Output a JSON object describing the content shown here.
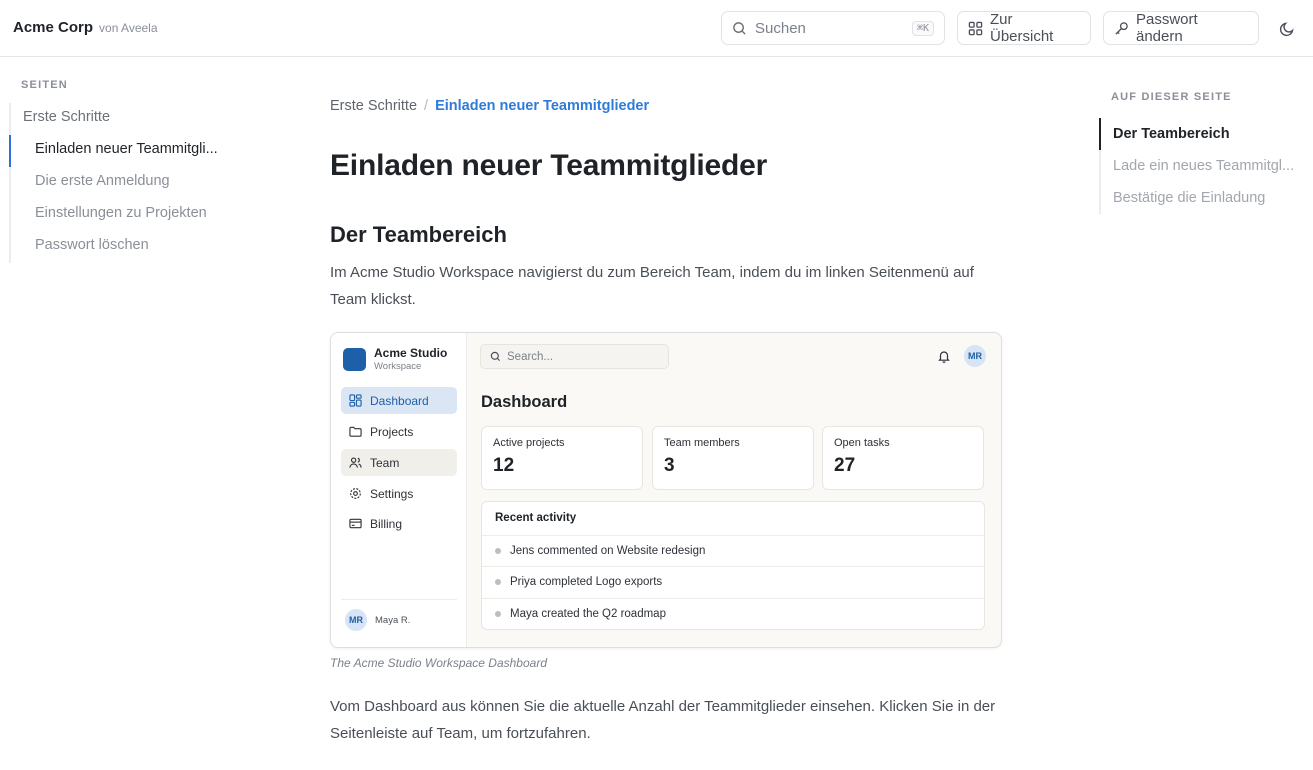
{
  "header": {
    "brand": "Acme Corp",
    "brand_sub": "von Aveela",
    "search_placeholder": "Suchen",
    "search_shortcut": "⌘K",
    "overview_label": "Zur Übersicht",
    "password_label": "Passwort ändern"
  },
  "sidebar": {
    "heading": "SEITEN",
    "parent": "Erste Schritte",
    "items": [
      "Einladen neuer Teammitgli...",
      "Die erste Anmeldung",
      "Einstellungen zu Projekten",
      "Passwort löschen"
    ]
  },
  "main": {
    "breadcrumb": {
      "root": "Erste Schritte",
      "sep": "/",
      "current": "Einladen neuer Teammitglieder"
    },
    "title": "Einladen neuer Teammitglieder",
    "section_title": "Der Teambereich",
    "para1": "Im Acme Studio Workspace navigierst du zum Bereich Team, indem du im linken Seitenmenü auf Team klickst.",
    "caption": "The Acme Studio Workspace Dashboard",
    "para2": "Vom Dashboard aus können Sie die aktuelle Anzahl der Teammitglieder einsehen. Klicken Sie in der Seitenleiste auf Team, um fortzufahren."
  },
  "shot": {
    "ws_name": "Acme Studio",
    "ws_sub": "Workspace",
    "search": "Search...",
    "avatar": "MR",
    "nav": [
      "Dashboard",
      "Projects",
      "Team",
      "Settings",
      "Billing"
    ],
    "user_initials": "MR",
    "user_name": "Maya R.",
    "title": "Dashboard",
    "stats": [
      {
        "label": "Active projects",
        "value": "12"
      },
      {
        "label": "Team members",
        "value": "3"
      },
      {
        "label": "Open tasks",
        "value": "27"
      }
    ],
    "activity_title": "Recent activity",
    "activity": [
      "Jens commented on Website redesign",
      "Priya completed Logo exports",
      "Maya created the Q2 roadmap"
    ]
  },
  "toc": {
    "heading": "AUF DIESER SEITE",
    "items": [
      "Der Teambereich",
      "Lade ein neues Teammitgl...",
      "Bestätige die Einladung"
    ]
  },
  "colors": {
    "accent": "#2f7bd9",
    "brand_logo": "#1d5fa8"
  }
}
